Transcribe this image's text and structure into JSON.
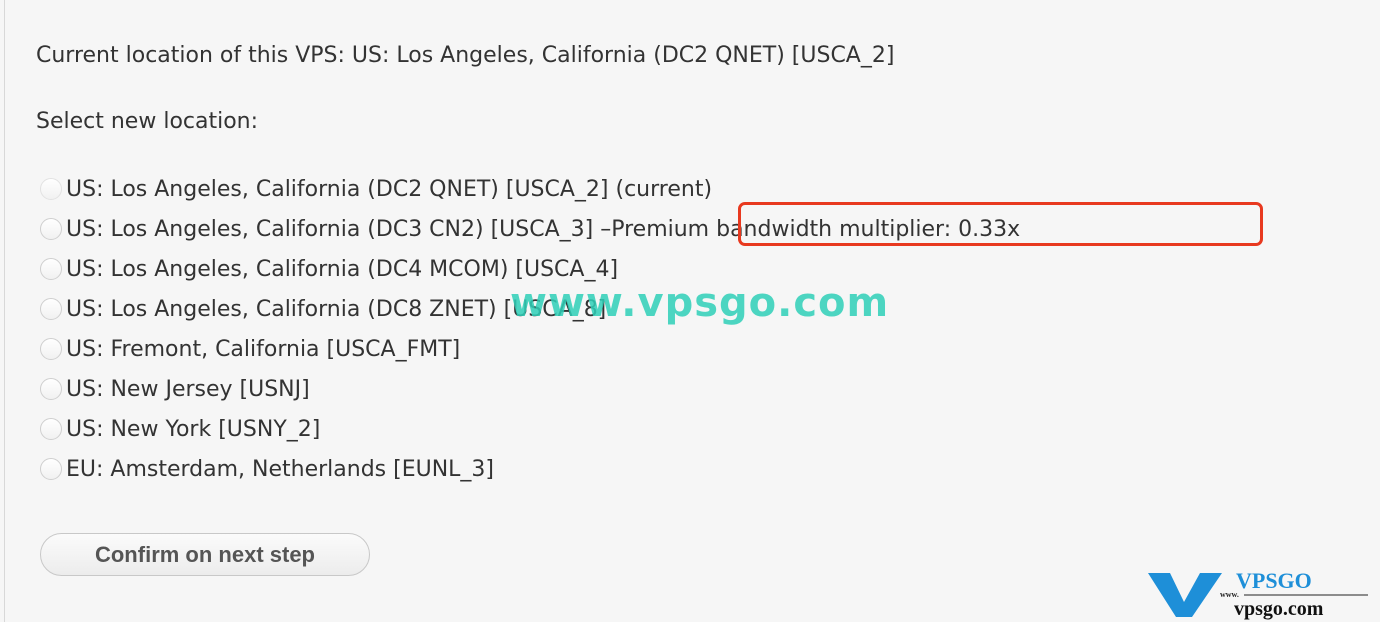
{
  "current_location": "Current location of this VPS: US: Los Angeles, California (DC2 QNET) [USCA_2]",
  "select_label": "Select new location:",
  "options": [
    {
      "label": "US: Los Angeles, California (DC2 QNET) [USCA_2] (current)",
      "disabled": true
    },
    {
      "label": "US: Los Angeles, California (DC3 CN2) [USCA_3] – ",
      "note": "Premium bandwidth multiplier: 0.33x"
    },
    {
      "label": "US: Los Angeles, California (DC4 MCOM) [USCA_4]"
    },
    {
      "label": "US: Los Angeles, California (DC8 ZNET) [USCA_8]"
    },
    {
      "label": "US: Fremont, California [USCA_FMT]"
    },
    {
      "label": "US: New Jersey [USNJ]"
    },
    {
      "label": "US: New York [USNY_2]"
    },
    {
      "label": "EU: Amsterdam, Netherlands [EUNL_3]"
    }
  ],
  "confirm_button": "Confirm on next step",
  "watermark": "www.vpsgo.com",
  "logo": {
    "brand": "VPSGO",
    "url_text": "www.vpsgo.com"
  },
  "colors": {
    "highlight": "#e8391f",
    "watermark": "#2fd0b8",
    "logo": "#1e8fd8"
  }
}
